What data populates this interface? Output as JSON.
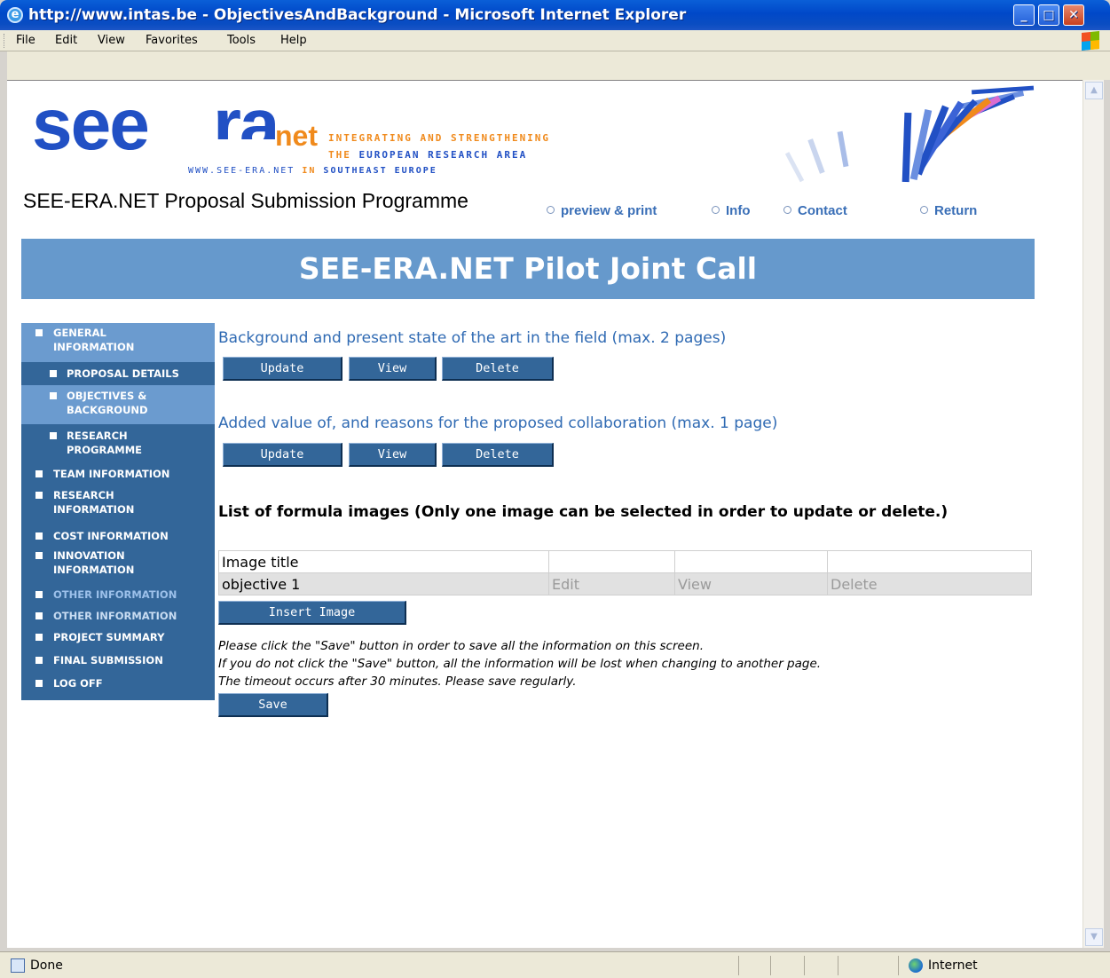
{
  "window": {
    "title": "http://www.intas.be - ObjectivesAndBackground - Microsoft Internet Explorer",
    "buttons": {
      "minimize": "_",
      "maximize": "□",
      "close": "✕"
    }
  },
  "menu": [
    "File",
    "Edit",
    "View",
    "Favorites",
    "Tools",
    "Help"
  ],
  "logo": {
    "see": "see",
    "ra": "ra",
    "net": "net",
    "tagline_line1": "INTEGRATING AND STRENGTHENING",
    "tagline_line2_a": "THE",
    "tagline_line2_b": "EUROPEAN RESEARCH AREA",
    "website": "WWW.SEE-ERA.NET",
    "tagline_line3_a": "IN",
    "tagline_line3_b": "SOUTHEAST EUROPE"
  },
  "header": {
    "programme_title": "SEE-ERA.NET Proposal Submission Programme",
    "links": [
      "preview & print",
      "Info",
      "Contact",
      "Return"
    ]
  },
  "banner": {
    "title": "SEE-ERA.NET Pilot Joint Call"
  },
  "sidebar": {
    "items": [
      {
        "label": "GENERAL INFORMATION"
      },
      {
        "label": "PROPOSAL DETAILS"
      },
      {
        "label": "OBJECTIVES & BACKGROUND"
      },
      {
        "label": "RESEARCH PROGRAMME"
      },
      {
        "label": "TEAM INFORMATION"
      },
      {
        "label": "RESEARCH INFORMATION"
      },
      {
        "label": "COST INFORMATION"
      },
      {
        "label": "INNOVATION INFORMATION"
      },
      {
        "label": "OTHER INFORMATION"
      },
      {
        "label": "OTHER INFORMATION"
      },
      {
        "label": "PROJECT SUMMARY"
      },
      {
        "label": "FINAL SUBMISSION"
      },
      {
        "label": "LOG OFF"
      }
    ]
  },
  "main": {
    "section1": {
      "label": "Background and present state of the art in the field (max. 2 pages)",
      "update": "Update",
      "view": "View",
      "delete": "Delete"
    },
    "section2": {
      "label": "Added value of, and reasons for the proposed collaboration (max. 1 page)",
      "update": "Update",
      "view": "View",
      "delete": "Delete"
    },
    "images": {
      "title": "List of formula images (Only one image can be selected in order to update or delete.)",
      "header": "Image title",
      "rows": [
        {
          "title": "objective 1",
          "edit": "Edit",
          "view": "View",
          "delete": "Delete"
        }
      ],
      "insert_button": "Insert Image"
    },
    "info": [
      "Please click the \"Save\" button in order to save all the information on this screen.",
      "If you do not click the \"Save\" button, all the information will be lost when changing to another page.",
      "The timeout occurs after 30 minutes. Please save regularly."
    ],
    "save_button": "Save"
  },
  "status": {
    "text": "Done",
    "zone": "Internet"
  }
}
